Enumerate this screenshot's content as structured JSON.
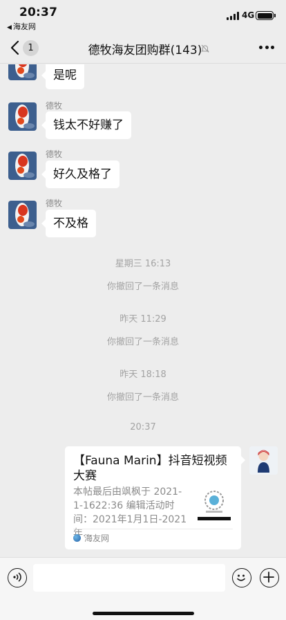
{
  "status": {
    "time": "20:37",
    "back_app": "海友网",
    "network": "4G"
  },
  "nav": {
    "badge": "1",
    "title": "德牧海友团购群(143)"
  },
  "messages": [
    {
      "sender": "",
      "text": "是呢"
    },
    {
      "sender": "德牧",
      "text": "钱太不好赚了"
    },
    {
      "sender": "德牧",
      "text": "好久及格了"
    },
    {
      "sender": "德牧",
      "text": "不及格"
    }
  ],
  "system": [
    "星期三 16:13",
    "你撤回了一条消息",
    "昨天 11:29",
    "你撤回了一条消息",
    "昨天 18:18",
    "你撤回了一条消息",
    "20:37"
  ],
  "card": {
    "title": "【Fauna Marin】抖音短视频大赛",
    "description": "本帖最后由飒枫于 2021-1-1622:36 编辑活动时间：2021年1月1日-2021年...",
    "source": "海友网"
  },
  "input": {
    "placeholder": ""
  },
  "icons": {
    "back": "chevron-left-icon",
    "mute": "bell-slash-icon",
    "more": "more-dots-icon",
    "voice": "voice-icon",
    "emoji": "emoji-icon",
    "plus": "plus-icon"
  }
}
